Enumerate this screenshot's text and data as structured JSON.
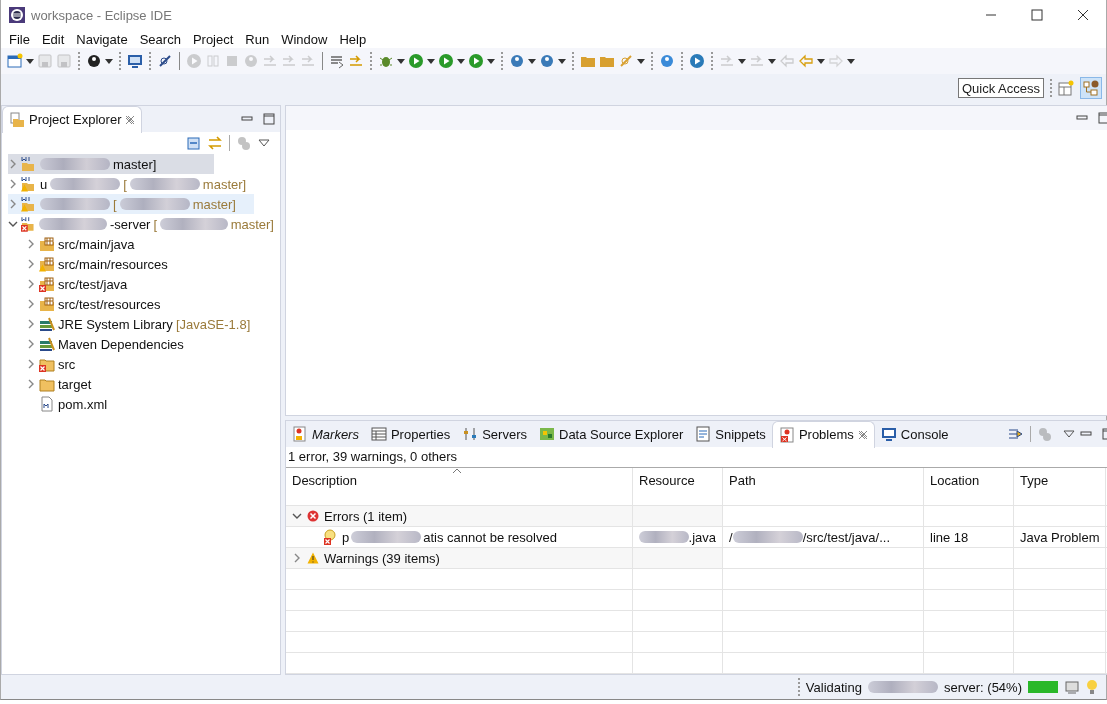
{
  "window": {
    "title": "workspace - Eclipse IDE"
  },
  "menu": [
    "File",
    "Edit",
    "Navigate",
    "Search",
    "Project",
    "Run",
    "Window",
    "Help"
  ],
  "quick_access": {
    "placeholder": "Quick Access"
  },
  "project_explorer": {
    "tab": {
      "label": "Project Explorer",
      "selected": true
    },
    "projects": [
      {
        "expanded": false,
        "selected": true,
        "hover": false,
        "has_error": false,
        "has_warning": false,
        "parts": [
          {
            "kind": "blur"
          },
          {
            "kind": "text",
            "text": "master]"
          }
        ]
      },
      {
        "expanded": false,
        "selected": false,
        "hover": false,
        "has_error": false,
        "has_warning": true,
        "parts": [
          {
            "kind": "text",
            "text": "u"
          },
          {
            "kind": "blur"
          },
          {
            "kind": "branch",
            "text": "["
          },
          {
            "kind": "blur"
          },
          {
            "kind": "branch",
            "text": "master]"
          }
        ]
      },
      {
        "expanded": false,
        "selected": false,
        "hover": true,
        "has_error": false,
        "has_warning": true,
        "parts": [
          {
            "kind": "blur"
          },
          {
            "kind": "branch",
            "text": "["
          },
          {
            "kind": "blur"
          },
          {
            "kind": "branch",
            "text": "master]"
          }
        ]
      },
      {
        "expanded": true,
        "selected": false,
        "hover": false,
        "has_error": true,
        "has_warning": false,
        "parts": [
          {
            "kind": "blur"
          },
          {
            "kind": "text",
            "text": "-server"
          },
          {
            "kind": "branch",
            "text": "["
          },
          {
            "kind": "blur"
          },
          {
            "kind": "branch",
            "text": "master]"
          }
        ],
        "children": [
          {
            "kind": "package",
            "has_error": false,
            "has_warning": false,
            "label": "src/main/java",
            "expanded": false
          },
          {
            "kind": "package",
            "has_error": false,
            "has_warning": true,
            "label": "src/main/resources",
            "expanded": false
          },
          {
            "kind": "package",
            "has_error": true,
            "has_warning": false,
            "label": "src/test/java",
            "expanded": false
          },
          {
            "kind": "package",
            "has_error": false,
            "has_warning": false,
            "label": "src/test/resources",
            "expanded": false
          },
          {
            "kind": "library",
            "has_error": false,
            "has_warning": false,
            "label": "JRE System Library",
            "decoration": "[JavaSE-1.8]",
            "expanded": false
          },
          {
            "kind": "library",
            "has_error": false,
            "has_warning": false,
            "label": "Maven Dependencies",
            "expanded": false
          },
          {
            "kind": "folder",
            "has_error": true,
            "has_warning": false,
            "label": "src",
            "expanded": false
          },
          {
            "kind": "folder",
            "has_error": false,
            "has_warning": false,
            "label": "target",
            "expanded": false
          },
          {
            "kind": "file",
            "has_error": false,
            "has_warning": false,
            "label": "pom.xml"
          }
        ]
      }
    ]
  },
  "bottom_tabs": [
    {
      "label": "Markers",
      "selected": false,
      "kind": "markers"
    },
    {
      "label": "Properties",
      "selected": false,
      "kind": "properties"
    },
    {
      "label": "Servers",
      "selected": false,
      "kind": "servers"
    },
    {
      "label": "Data Source Explorer",
      "selected": false,
      "kind": "datasource"
    },
    {
      "label": "Snippets",
      "selected": false,
      "kind": "snippets"
    },
    {
      "label": "Problems",
      "selected": true,
      "kind": "problems"
    },
    {
      "label": "Console",
      "selected": false,
      "kind": "console"
    }
  ],
  "problems": {
    "summary": "1 error, 39 warnings, 0 others",
    "columns": [
      "Description",
      "Resource",
      "Path",
      "Location",
      "Type"
    ],
    "groups": [
      {
        "kind": "error",
        "label": "Errors (1 item)",
        "expanded": true,
        "items": [
          {
            "description": [
              {
                "kind": "text",
                "text": "p"
              },
              {
                "kind": "blur"
              },
              {
                "kind": "text",
                "text": "atis cannot be resolved"
              }
            ],
            "resource": [
              {
                "kind": "blur"
              },
              {
                "kind": "text",
                "text": ".java"
              }
            ],
            "path": [
              {
                "kind": "text",
                "text": "/"
              },
              {
                "kind": "blur"
              },
              {
                "kind": "text",
                "text": "/src/test/java/..."
              }
            ],
            "location": "line 18",
            "type": "Java Problem"
          }
        ]
      },
      {
        "kind": "warning",
        "label": "Warnings (39 items)",
        "expanded": false
      }
    ]
  },
  "status_bar": {
    "parts": [
      {
        "kind": "text",
        "text": "Validating"
      },
      {
        "kind": "blur"
      },
      {
        "kind": "text",
        "text": "server: (54%)"
      }
    ],
    "progress": {
      "level": 1
    }
  }
}
